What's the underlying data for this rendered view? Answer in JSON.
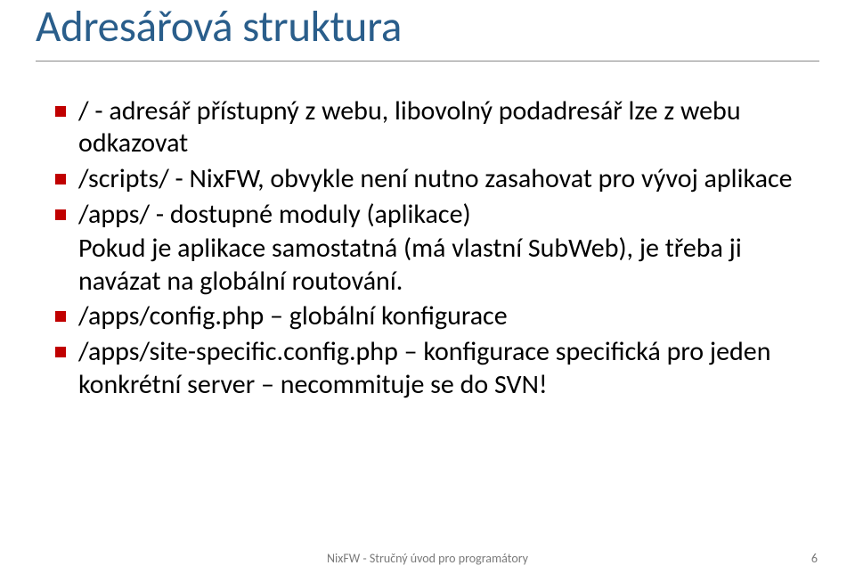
{
  "title": "Adresářová struktura",
  "bullets": [
    {
      "text": "/ - adresář přístupný z webu, libovolný podadresář lze z webu odkazovat"
    },
    {
      "text": "/scripts/ - NixFW, obvykle není nutno zasahovat pro vývoj aplikace"
    },
    {
      "text": "/apps/ - dostupné moduly (aplikace)",
      "sub": "Pokud je aplikace samostatná (má vlastní SubWeb), je třeba ji navázat na globální routování."
    },
    {
      "text": "/apps/config.php – globální konfigurace"
    },
    {
      "text": "/apps/site-specific.config.php – konfigurace specifická pro jeden konkrétní server – necommituje se do SVN!"
    }
  ],
  "footer": "NixFW - Stručný úvod pro programátory",
  "page_number": "6"
}
